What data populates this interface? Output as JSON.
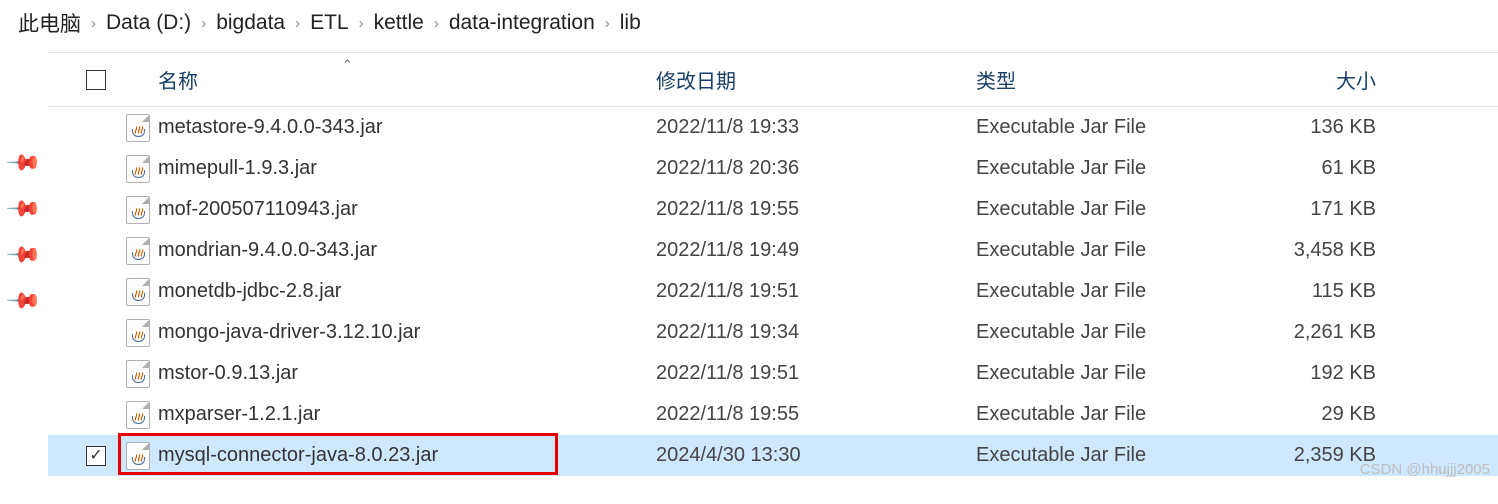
{
  "breadcrumb": [
    {
      "label": "此电脑"
    },
    {
      "label": "Data (D:)"
    },
    {
      "label": "bigdata"
    },
    {
      "label": "ETL"
    },
    {
      "label": "kettle"
    },
    {
      "label": "data-integration"
    },
    {
      "label": "lib"
    }
  ],
  "columns": {
    "name": "名称",
    "date": "修改日期",
    "type": "类型",
    "size": "大小"
  },
  "files": [
    {
      "name": "metastore-9.4.0.0-343.jar",
      "date": "2022/11/8 19:33",
      "type": "Executable Jar File",
      "size": "136 KB",
      "selected": false
    },
    {
      "name": "mimepull-1.9.3.jar",
      "date": "2022/11/8 20:36",
      "type": "Executable Jar File",
      "size": "61 KB",
      "selected": false
    },
    {
      "name": "mof-200507110943.jar",
      "date": "2022/11/8 19:55",
      "type": "Executable Jar File",
      "size": "171 KB",
      "selected": false
    },
    {
      "name": "mondrian-9.4.0.0-343.jar",
      "date": "2022/11/8 19:49",
      "type": "Executable Jar File",
      "size": "3,458 KB",
      "selected": false
    },
    {
      "name": "monetdb-jdbc-2.8.jar",
      "date": "2022/11/8 19:51",
      "type": "Executable Jar File",
      "size": "115 KB",
      "selected": false
    },
    {
      "name": "mongo-java-driver-3.12.10.jar",
      "date": "2022/11/8 19:34",
      "type": "Executable Jar File",
      "size": "2,261 KB",
      "selected": false
    },
    {
      "name": "mstor-0.9.13.jar",
      "date": "2022/11/8 19:51",
      "type": "Executable Jar File",
      "size": "192 KB",
      "selected": false
    },
    {
      "name": "mxparser-1.2.1.jar",
      "date": "2022/11/8 19:55",
      "type": "Executable Jar File",
      "size": "29 KB",
      "selected": false
    },
    {
      "name": "mysql-connector-java-8.0.23.jar",
      "date": "2024/4/30 13:30",
      "type": "Executable Jar File",
      "size": "2,359 KB",
      "selected": true
    }
  ],
  "watermark": "CSDN @hhujjj2005"
}
